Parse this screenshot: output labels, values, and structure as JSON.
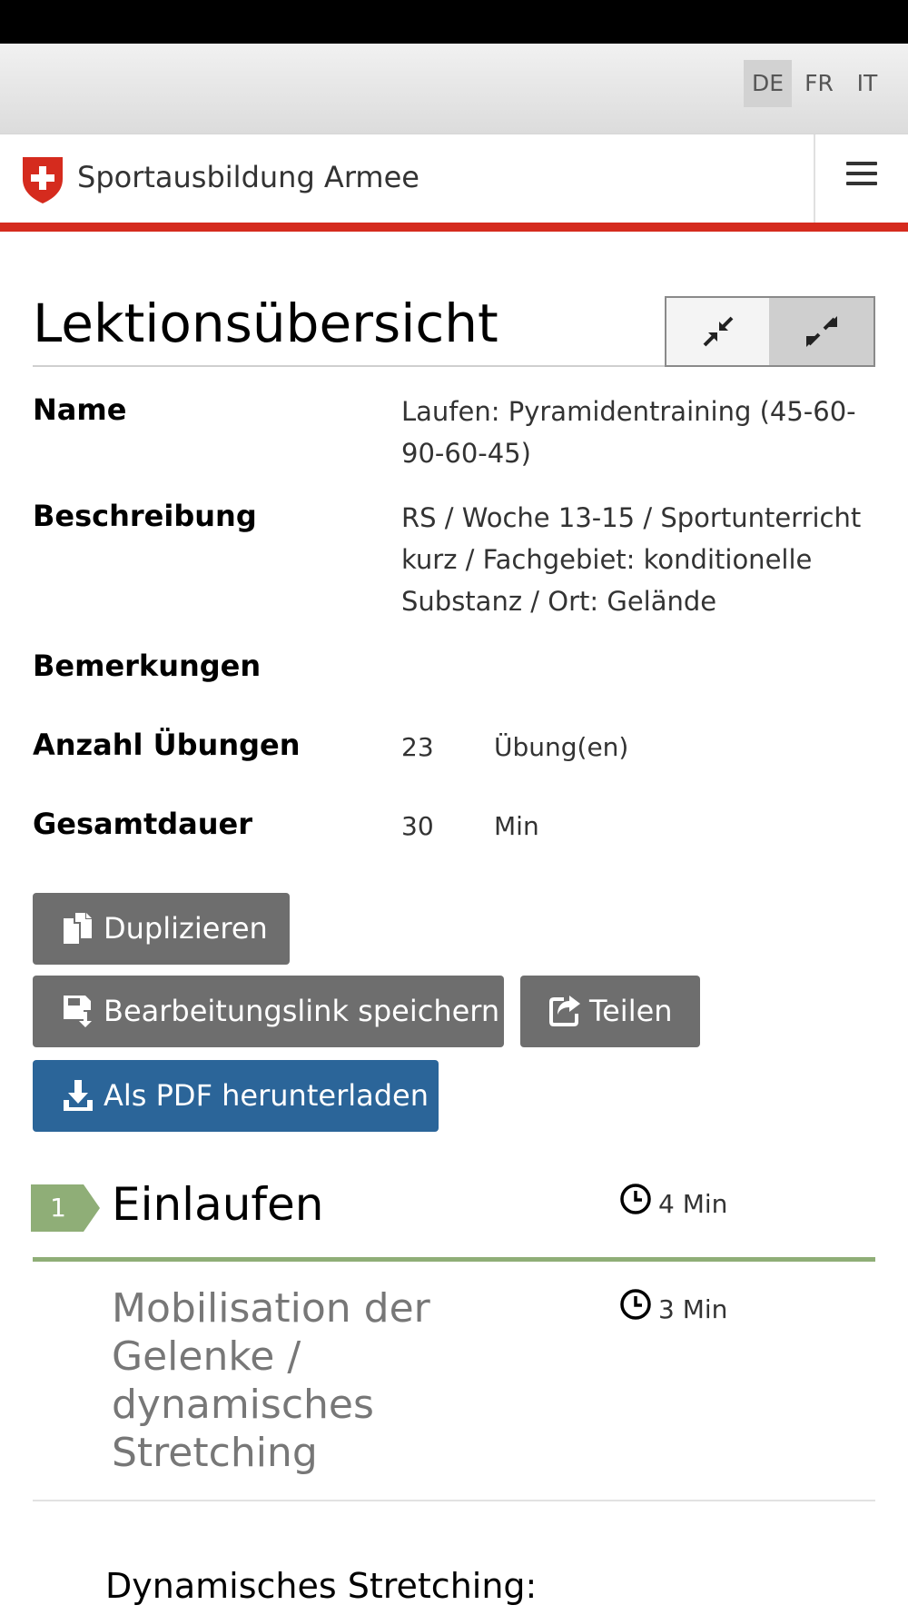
{
  "languages": [
    "DE",
    "FR",
    "IT"
  ],
  "header": {
    "site_title": "Sportausbildung Armee"
  },
  "page": {
    "title": "Lektionsübersicht"
  },
  "info": {
    "name_label": "Name",
    "name_value": "Laufen: Pyramidentraining (45-60-90-60-45)",
    "description_label": "Beschreibung",
    "description_value": "RS / Woche 13-15 / Sportunterricht kurz / Fachgebiet: konditionelle Substanz / Ort: Gelände",
    "remarks_label": "Bemerkungen",
    "exercise_count_label": "Anzahl Übungen",
    "exercise_count": "23",
    "exercise_unit": "Übung(en)",
    "duration_label": "Gesamtdauer",
    "duration_value": "30",
    "duration_unit": "Min"
  },
  "actions": {
    "duplicate": "Duplizieren",
    "save_link": "Bearbeitungslink speichern",
    "share": "Teilen",
    "pdf": "Als PDF herunterladen"
  },
  "section": {
    "number": "1",
    "title": "Einlaufen",
    "duration": "4 Min"
  },
  "exercise": {
    "title": "Mobilisation der Gelenke / dynamisches Stretching",
    "duration": "3 Min",
    "subheading": "Dynamisches Stretching:"
  },
  "colors": {
    "swiss_red": "#d52b1e",
    "button_gray": "#6e6e6e",
    "primary_blue": "#2b6599",
    "section_green": "#8fae77"
  },
  "icons": {
    "logo": "swiss-cross-shield-icon",
    "menu": "hamburger-icon",
    "collapse": "compress-icon",
    "expand": "expand-icon",
    "duplicate": "copy-icon",
    "save": "save-icon",
    "share": "share-icon",
    "pdf": "download-icon",
    "duration": "clock-icon"
  }
}
